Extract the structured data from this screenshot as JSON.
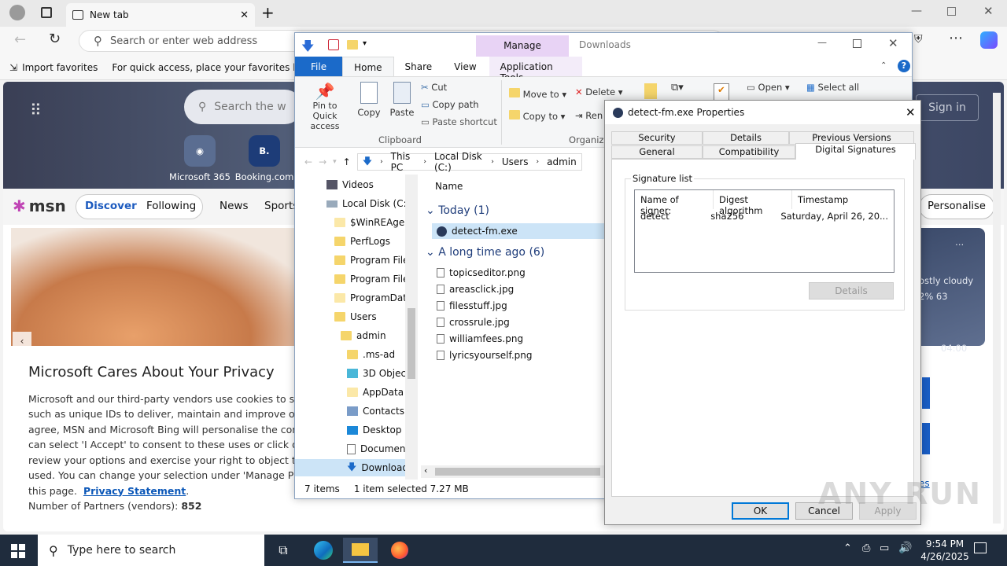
{
  "edge": {
    "tab_title": "New tab",
    "address_placeholder": "Search or enter web address",
    "favbar_import": "Import favorites",
    "favbar_hint": "For quick access, place your favorites here o",
    "hero_search_placeholder": "Search the w",
    "hero_apps": [
      {
        "label": "Microsoft 365"
      },
      {
        "label": "Booking.com",
        "letter": "B."
      }
    ],
    "sign_in": "Sign in",
    "msn_logo": "msn",
    "msn_nav": [
      "Discover",
      "Following",
      "News",
      "Sports"
    ],
    "personalise": "Personalise",
    "weather_text": "ostly cloudy",
    "weather_stats": "2%   63",
    "weather_time": "04:00",
    "privacy": {
      "title": "Microsoft Cares About Your Privacy",
      "lines": [
        "Microsoft and our third-party vendors use cookies to stor",
        "such as unique IDs to deliver, maintain and improve our se",
        "agree, MSN and Microsoft Bing will personalise the conten",
        "can select 'I Accept' to consent to these uses or click on 'M",
        "review your options and exercise your right to object to Le",
        "used.  You can change your selection under 'Manage Prefe"
      ],
      "line7_prefix": "this page.",
      "link": "Privacy Statement",
      "link_suffix": ".",
      "partners_label": "Number of Partners (vendors): ",
      "partners_count": "852",
      "link_es": "es"
    }
  },
  "explorer": {
    "title_manage": "Manage",
    "title_downloads": "Downloads",
    "ribbon_tabs": [
      "File",
      "Home",
      "Share",
      "View",
      "Application Tools"
    ],
    "clipboard": {
      "pin": "Pin to Quick access",
      "copy": "Copy",
      "paste": "Paste",
      "cut": "Cut",
      "copy_path": "Copy path",
      "paste_shortcut": "Paste shortcut",
      "group": "Clipboard"
    },
    "organize": {
      "move_to": "Move to",
      "copy_to": "Copy to",
      "delete": "Delete",
      "rename": "Ren",
      "group": "Organize"
    },
    "open": "Open",
    "select_all": "Select all",
    "path": [
      "This PC",
      "Local Disk (C:)",
      "Users",
      "admin"
    ],
    "nav_items": [
      "Videos",
      "Local Disk (C:)",
      "$WinREAgent",
      "PerfLogs",
      "Program Files",
      "Program Files",
      "ProgramData",
      "Users",
      "admin",
      ".ms-ad",
      "3D Objects",
      "AppData",
      "Contacts",
      "Desktop",
      "Documents",
      "Downloads"
    ],
    "column_name": "Name",
    "group_today": "Today (1)",
    "today_file": "detect-fm.exe",
    "group_old": "A long time ago (6)",
    "old_files": [
      "topicseditor.png",
      "areasclick.jpg",
      "filesstuff.jpg",
      "crossrule.jpg",
      "williamfees.png",
      "lyricsyourself.png"
    ],
    "status_items": "7 items",
    "status_selected": "1 item selected  7.27 MB"
  },
  "properties": {
    "title": "detect-fm.exe Properties",
    "tabs_row1": [
      "Security",
      "Details",
      "Previous Versions"
    ],
    "tabs_row2": [
      "General",
      "Compatibility",
      "Digital Signatures"
    ],
    "signature_list_label": "Signature list",
    "columns": [
      "Name of signer:",
      "Digest algorithm",
      "Timestamp"
    ],
    "row": [
      "detect",
      "sha256",
      "Saturday, April 26, 20..."
    ],
    "details_button": "Details",
    "ok": "OK",
    "cancel": "Cancel",
    "apply": "Apply"
  },
  "taskbar": {
    "search_placeholder": "Type here to search",
    "time": "9:54 PM",
    "date": "4/26/2025"
  },
  "watermark": "ANY RUN",
  "colors": {
    "accent": "#0067c0",
    "taskbar": "#1f2c3d",
    "manage_tab": "#e8d3f5"
  }
}
